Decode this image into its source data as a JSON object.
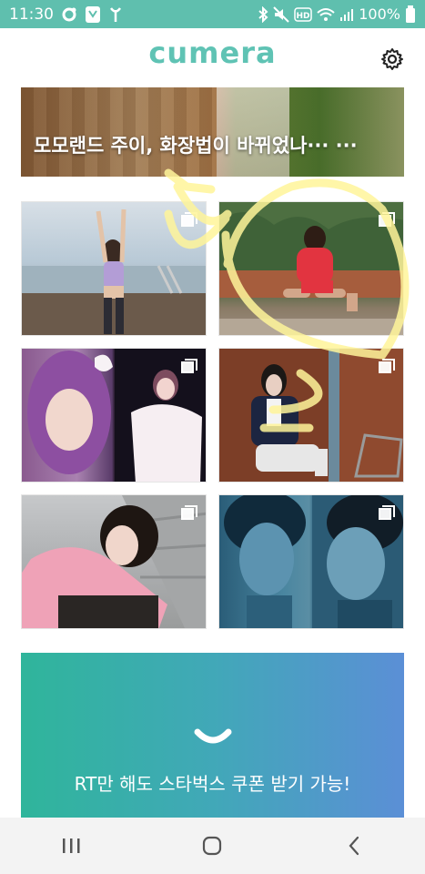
{
  "status_bar": {
    "time": "11:30",
    "battery": "100%",
    "icons": [
      "settings-dot-icon",
      "carrier-icon",
      "antenna-icon",
      "bluetooth-icon",
      "mute-icon",
      "hd-icon",
      "wifi-icon",
      "signal-icon",
      "battery-icon"
    ],
    "hd_label": "HD"
  },
  "header": {
    "logo": "cumera",
    "settings_icon": "gear-icon"
  },
  "banner": {
    "title": "모모랜드 주이, 화장법이 바뀌었나··· ···"
  },
  "feed": {
    "badge_icon": "multi-photo-icon",
    "items": [
      {
        "label": "photo-1"
      },
      {
        "label": "photo-2"
      },
      {
        "label": "photo-3"
      },
      {
        "label": "photo-4"
      },
      {
        "label": "photo-5"
      },
      {
        "label": "photo-6"
      }
    ]
  },
  "promo": {
    "text": "RT만 해도 스타벅스 쿠폰 받기 가능!"
  },
  "nav": {
    "recent_icon": "recent-apps-icon",
    "home_icon": "home-icon",
    "back_icon": "back-icon"
  },
  "colors": {
    "status_bar": "#5fbfae",
    "logo": "#5fc3b4",
    "promo_start": "#2fb59b",
    "promo_end": "#5b8fd6",
    "scribble": "#fff59a"
  }
}
